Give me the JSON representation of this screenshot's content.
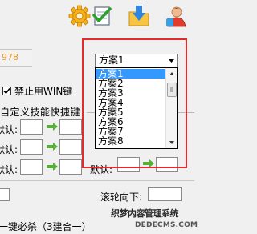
{
  "header": {
    "field_value": "978"
  },
  "toolbar": {
    "icons": [
      "gear-icon",
      "checklist-icon",
      "download-icon",
      "user-icon"
    ]
  },
  "options": {
    "disable_win_label": "禁止用WIN键",
    "disable_win_checked": true
  },
  "skills_group": {
    "title": "自定义技能快捷键",
    "row_label": "默认:",
    "right_label": "默认:"
  },
  "scheme_combo": {
    "selected": "方案1",
    "options": [
      "方案1",
      "方案2",
      "方案3",
      "方案4",
      "方案5",
      "方案6",
      "方案7",
      "方案8"
    ]
  },
  "bottom": {
    "scroll_down_label": "滚轮向下:",
    "one_key_label": "一键必杀（3建合一）"
  },
  "watermark": {
    "line1": "织梦内容管理系统",
    "line2": "DEDECMS.COM"
  },
  "colors": {
    "highlight_border": "#e52a2a",
    "selection": "#3399ff",
    "arrow_green": "#55b035"
  }
}
